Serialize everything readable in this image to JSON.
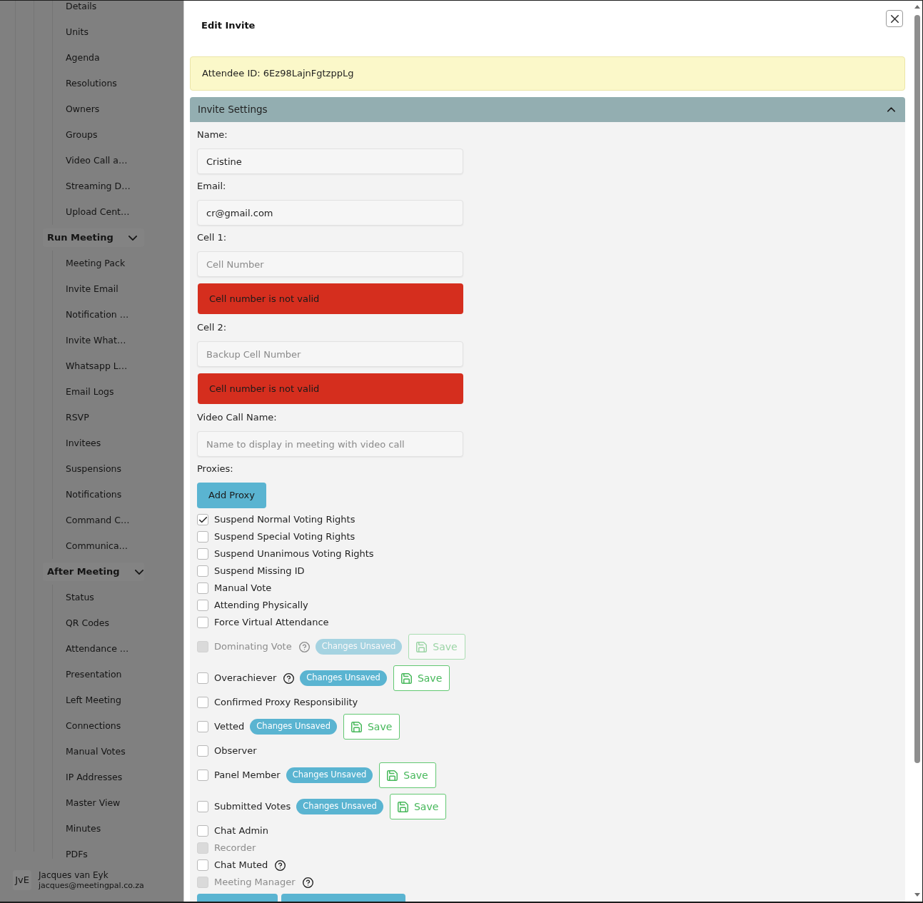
{
  "sidebar": {
    "sections": [
      {
        "items": [
          "Details",
          "Units",
          "Agenda",
          "Resolutions",
          "Owners",
          "Groups",
          "Video Call a…",
          "Streaming D…",
          "Upload Cent…"
        ]
      },
      {
        "title": "Run Meeting",
        "expanded": true,
        "items": [
          "Meeting Pack",
          "Invite Email",
          "Notification …",
          "Invite What…",
          "Whatsapp L…",
          "Email Logs",
          "RSVP",
          "Invitees",
          "Suspensions",
          "Notifications",
          "Command C…",
          "Communica…"
        ]
      },
      {
        "title": "After Meeting",
        "expanded": true,
        "items": [
          "Status",
          "QR Codes",
          "Attendance …",
          "Presentation",
          "Left Meeting",
          "Connections",
          "Manual Votes",
          "IP Addresses",
          "Master View",
          "Minutes",
          "PDFs"
        ]
      }
    ],
    "user": {
      "initials": "JvE",
      "name": "Jacques van Eyk",
      "email": "jacques@meetingpal.co.za"
    }
  },
  "dialog": {
    "title": "Edit Invite",
    "attendee_id": "Attendee ID: 6Ez98LajnFgtzppLg",
    "section": {
      "title": "Invite Settings",
      "expanded": true,
      "fields": [
        {
          "label": "Name:",
          "value": "Cristine"
        },
        {
          "label": "Email:",
          "value": "cr@gmail.com"
        },
        {
          "label": "Cell 1:",
          "placeholder": "Cell Number",
          "error": "Cell number is not valid"
        },
        {
          "label": "Cell 2:",
          "placeholder": "Backup Cell Number",
          "error": "Cell number is not valid"
        },
        {
          "label": "Video Call Name:",
          "placeholder": "Name to display in meeting with video call"
        }
      ],
      "proxies": {
        "label": "Proxies:",
        "button": "Add Proxy"
      },
      "options": [
        {
          "label": "Suspend Normal Voting Rights",
          "checked": true,
          "disabled": false,
          "help": false
        },
        {
          "label": "Suspend Special Voting Rights",
          "checked": false,
          "disabled": false,
          "help": false
        },
        {
          "label": "Suspend Unanimous Voting Rights",
          "checked": false,
          "disabled": false,
          "help": false
        },
        {
          "label": "Suspend Missing ID",
          "checked": false,
          "disabled": false,
          "help": false
        },
        {
          "label": "Manual Vote",
          "checked": false,
          "disabled": false,
          "help": false
        },
        {
          "label": "Attending Physically",
          "checked": false,
          "disabled": false,
          "help": false
        },
        {
          "label": "Force Virtual Attendance",
          "checked": false,
          "disabled": false,
          "help": false
        },
        {
          "label": "Dominating Vote",
          "checked": false,
          "disabled": true,
          "help": true,
          "unsaved": {
            "badge": "Changes Unsaved",
            "button": "Save"
          }
        },
        {
          "label": "Overachiever",
          "checked": false,
          "disabled": false,
          "help": true,
          "unsaved": {
            "badge": "Changes Unsaved",
            "button": "Save"
          }
        },
        {
          "label": "Confirmed Proxy Responsibility",
          "checked": false,
          "disabled": false,
          "help": false
        },
        {
          "label": "Vetted",
          "checked": false,
          "disabled": false,
          "help": false,
          "unsaved": {
            "badge": "Changes Unsaved",
            "button": "Save"
          }
        },
        {
          "label": "Observer",
          "checked": false,
          "disabled": false,
          "help": false
        },
        {
          "label": "Panel Member",
          "checked": false,
          "disabled": false,
          "help": false,
          "unsaved": {
            "badge": "Changes Unsaved",
            "button": "Save"
          }
        },
        {
          "label": "Submitted Votes",
          "checked": false,
          "disabled": false,
          "help": false,
          "unsaved": {
            "badge": "Changes Unsaved",
            "button": "Save"
          }
        },
        {
          "label": "Chat Admin",
          "checked": false,
          "disabled": false,
          "help": false
        },
        {
          "label": "Recorder",
          "checked": false,
          "disabled": true,
          "help": false
        },
        {
          "label": "Chat Muted",
          "checked": false,
          "disabled": false,
          "help": true
        },
        {
          "label": "Meeting Manager",
          "checked": false,
          "disabled": true,
          "help": true
        }
      ]
    }
  }
}
